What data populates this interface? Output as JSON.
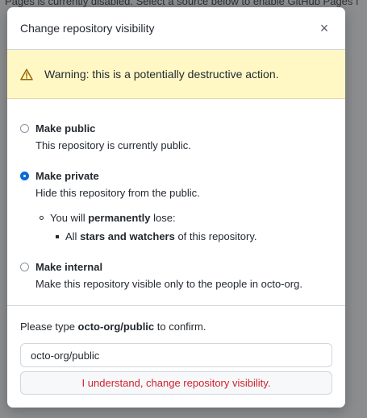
{
  "background": {
    "top_fragment": "Pages is currently disabled. Select a source below to enable GitHub Pages f"
  },
  "dialog": {
    "title": "Change repository visibility",
    "close_glyph": "×",
    "warning_text": "Warning: this is a potentially destructive action.",
    "options": [
      {
        "title": "Make public",
        "description": "This repository is currently public.",
        "selected": false
      },
      {
        "title": "Make private",
        "description": "Hide this repository from the public.",
        "selected": true,
        "consequence_prefix": "You will ",
        "consequence_bold": "permanently",
        "consequence_suffix": " lose:",
        "loss_prefix": "All ",
        "loss_bold": "stars and watchers",
        "loss_suffix": " of this repository."
      },
      {
        "title": "Make internal",
        "description": "Make this repository visible only to the people in octo-org.",
        "selected": false
      }
    ],
    "confirm_prefix": "Please type ",
    "confirm_repo": "octo-org/public",
    "confirm_suffix": " to confirm.",
    "input_value": "octo-org/public",
    "submit_label": "I understand, change repository visibility."
  },
  "colors": {
    "accent": "#0969da",
    "danger": "#cf222e",
    "warning_bg": "#fff8c5"
  },
  "icons": {
    "warning": "alert-triangle-icon",
    "close": "close-icon"
  }
}
